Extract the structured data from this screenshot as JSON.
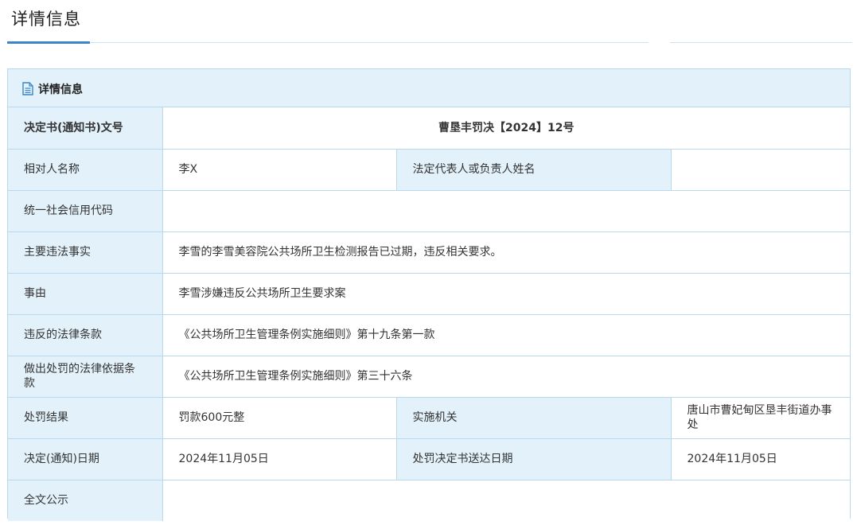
{
  "page": {
    "title": "详情信息"
  },
  "panel": {
    "title": "详情信息",
    "icon": "document-icon"
  },
  "colors": {
    "accent": "#3a86c8",
    "label_bg": "#e3f1fa",
    "border": "#b8d9ec"
  },
  "record": {
    "decision_no": {
      "label": "决定书(通知书)文号",
      "value": "曹垦丰罚决【2024】12号"
    },
    "party_name": {
      "label": "相对人名称",
      "value": "李X"
    },
    "legal_rep": {
      "label": "法定代表人或负责人姓名",
      "value": ""
    },
    "credit_code": {
      "label": "统一社会信用代码",
      "value": ""
    },
    "facts": {
      "label": "主要违法事实",
      "value": "李雪的李雪美容院公共场所卫生检测报告已过期，违反相关要求。"
    },
    "cause": {
      "label": "事由",
      "value": "李雪涉嫌违反公共场所卫生要求案"
    },
    "violated_law": {
      "label": "违反的法律条款",
      "value": "《公共场所卫生管理条例实施细则》第十九条第一款"
    },
    "penalty_basis": {
      "label": "做出处罚的法律依据条款",
      "value": "《公共场所卫生管理条例实施细则》第三十六条"
    },
    "result": {
      "label": "处罚结果",
      "value": "罚款600元整"
    },
    "agency": {
      "label": "实施机关",
      "value": "唐山市曹妃甸区垦丰街道办事处"
    },
    "decision_date": {
      "label": "决定(通知)日期",
      "value": "2024年11月05日"
    },
    "delivery_date": {
      "label": "处罚决定书送达日期",
      "value": "2024年11月05日"
    },
    "full_text": {
      "label": "全文公示",
      "value": ""
    }
  }
}
